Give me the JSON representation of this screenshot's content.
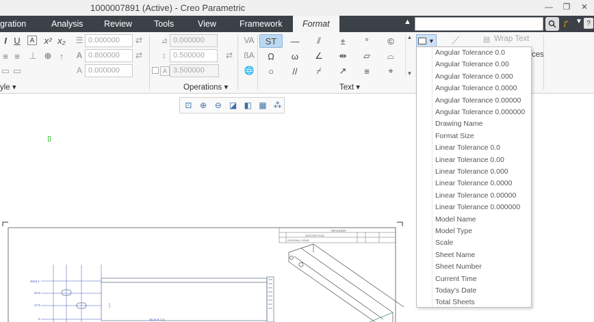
{
  "window": {
    "title": "1000007891 (Active) - Creo Parametric"
  },
  "tabs": [
    {
      "label": "gration"
    },
    {
      "label": "Analysis"
    },
    {
      "label": "Review"
    },
    {
      "label": "Tools"
    },
    {
      "label": "View"
    },
    {
      "label": "Framework"
    },
    {
      "label": "Format"
    }
  ],
  "ribbon": {
    "fields": {
      "a": "0.000000",
      "b": "0.800000",
      "c": "0.000000",
      "d": "0.000000",
      "e": "0.500000",
      "f": "3.500000"
    },
    "groups": {
      "style": "yle",
      "operations": "Operations",
      "text": "Text"
    },
    "wrap_text": "Wrap Text",
    "partial_label": "ces"
  },
  "symbols": [
    "ST",
    "—",
    "⫽",
    "±",
    "°",
    "©",
    "Ω",
    "ω",
    "∠",
    "⇹",
    "▱",
    "⌓",
    "○",
    "//",
    "⌿",
    "↗",
    "≡",
    "⌖"
  ],
  "dropdown": {
    "items": [
      "Angular Tolerance 0.0",
      "Angular Tolerance 0.00",
      "Angular Tolerance 0.000",
      "Angular Tolerance 0.0000",
      "Angular Tolerance 0.00000",
      "Angular Tolerance 0.000000",
      "Drawing Name",
      "Format Size",
      "Linear Tolerance 0.0",
      "Linear Tolerance 0.00",
      "Linear Tolerance 0.000",
      "Linear Tolerance 0.0000",
      "Linear Tolerance 0.00000",
      "Linear Tolerance 0.000000",
      "Model Name",
      "Model Type",
      "Scale",
      "Sheet Name",
      "Sheet Number",
      "Current Time",
      "Today's Date",
      "Total Sheets"
    ]
  },
  "drawing": {
    "revision_title": "REVISION",
    "description_header": "DESCRIPTION",
    "row_label": "ORIGINAL ISSUE",
    "scale_label": "SCALE  1:4",
    "dims": [
      "40±0.1",
      "42.5",
      "17.5",
      "0"
    ]
  }
}
